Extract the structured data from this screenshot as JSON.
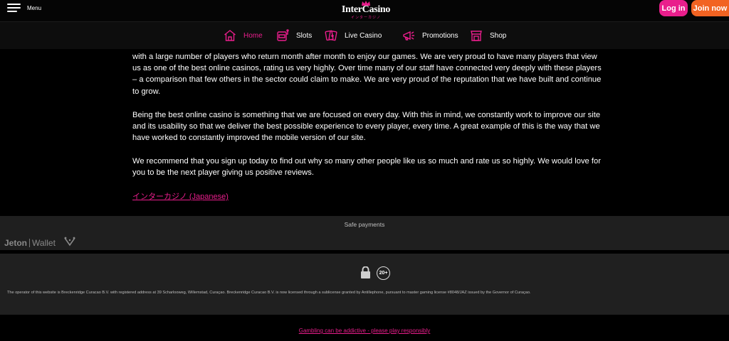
{
  "header": {
    "menu_label": "Menu",
    "logo_text": "InterCasino",
    "logo_subtext": "インターカジノ",
    "login_label": "Log in",
    "join_label": "Join now"
  },
  "nav": {
    "items": [
      {
        "label": "Home",
        "icon": "home-icon",
        "active": true
      },
      {
        "label": "Slots",
        "icon": "slot-machine-icon"
      },
      {
        "label": "Live Casino",
        "icon": "cards-icon"
      },
      {
        "label": "Promotions",
        "icon": "megaphone-icon"
      },
      {
        "label": "Shop",
        "icon": "shop-icon"
      }
    ]
  },
  "article": {
    "paragraph_1": "with a large number of players who return month after month to enjoy our games. We are very proud to have many players that view us as one of the best online casinos, rating us very highly. Over time many of our staff have connected very deeply with these players – a comparison that few others in the sector could claim to make. We are very proud of the reputation that we have built and continue to grow.",
    "paragraph_2": "Being the best online casino is something that we are focused on every day. With this in mind, we constantly work to improve our site and its usability so that we deliver the best possible experience to every player, every time. A great example of this is the way that we have worked to constantly improved the mobile version of our site.",
    "paragraph_3": "We recommend that you sign up today to find out why so many other people like us so much and rate us so highly. We would love for you to be the next player giving us positive reviews.",
    "language_link": "インターカジノ (Japanese)"
  },
  "payments": {
    "title": "Safe payments",
    "jeton_brand": "Jeton",
    "jeton_product": "Wallet"
  },
  "footer": {
    "age_badge": "20+",
    "license_text": "The operator of this website is Breckenridge Curacao B.V. with registered address at 39 Scharlooweg, Willemstad, Curaçao. Breckenridge Curacao B.V. is now licensed through a sublicense granted by Antillephone, pursuant to master gaming license #8048/JAZ issued by the Governor of Curaçao.",
    "responsible_link": "Gambling can be addictive - please play responsibly"
  },
  "colors": {
    "accent_pink": "#e91e8c",
    "accent_orange": "#f26322",
    "background": "#000000"
  }
}
